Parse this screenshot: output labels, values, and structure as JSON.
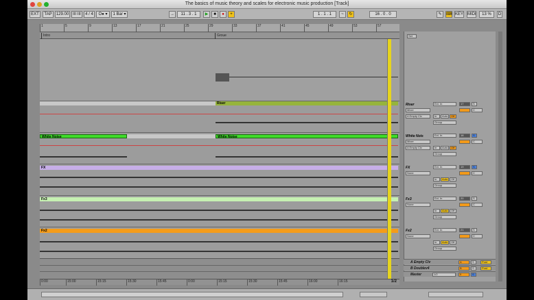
{
  "window": {
    "title": "The basics of music theory and scales for electronic music production  [Track]"
  },
  "transport": {
    "ext": "EXT",
    "tap": "TAP",
    "tempo": "129.00",
    "nudge": "III III",
    "sig": "4 / 4",
    "metro": "O● ▾",
    "quant": "1 Bar ▾",
    "position": "11 .  3 .  1",
    "loop_start": "1 .  1 .  1",
    "loop_len": "16 .  0 .  0",
    "key": "KEY",
    "midi": "MIDI",
    "cpu": "13 %",
    "d_label": "D"
  },
  "ruler": {
    "ticks": [
      "1",
      "5",
      "9",
      "13",
      "17",
      "21",
      "25",
      "29",
      "33",
      "37",
      "41",
      "45",
      "49",
      "53",
      "57"
    ]
  },
  "locators": [
    {
      "label": "Intro"
    },
    {
      "label": "Groue"
    }
  ],
  "tracks": [
    {
      "name": "Riser",
      "clip": "Riser",
      "input": "Ext. In",
      "mode": "Mixer",
      "out": "A Empty Clv",
      "num": "17",
      "group": "Group",
      "clip_color": "#96b43c"
    },
    {
      "name": "White Nois",
      "clip": "White Noise",
      "input": "Ext. In",
      "mode": "Mixer",
      "out": "A Empty Clv",
      "num": "18",
      "group": "Group",
      "clip_color": "#3fdc2a"
    },
    {
      "name": "FX",
      "clip": "FX",
      "input": "Ext. In",
      "mode": "None",
      "out": "",
      "num": "19",
      "group": "Group",
      "clip_color": "#c7aee8"
    },
    {
      "name": "Fx3",
      "clip": "Fx3",
      "input": "Ext. In",
      "mode": "None",
      "out": "",
      "num": "20",
      "group": "Group",
      "clip_color": "#c6f0b2"
    },
    {
      "name": "Fx2",
      "clip": "Fx2",
      "input": "Ext. In",
      "mode": "None",
      "out": "",
      "num": "21",
      "group": "Group",
      "clip_color": "#f49c1a"
    }
  ],
  "track_labels": {
    "in": "In",
    "auto": "Auto",
    "off": "Off",
    "s": "S",
    "c": "C"
  },
  "returns": [
    {
      "name": "A Empty Clv",
      "letter": "A",
      "post": "Post"
    },
    {
      "name": "B Doublev4",
      "letter": "B",
      "post": "Post"
    },
    {
      "name": "Master",
      "ratio": "1/2",
      "letter": "0"
    }
  ],
  "timeline": {
    "ticks": [
      "0:00",
      "15:00",
      "15:15",
      "15:30",
      "15:45",
      "0:00",
      "15:15",
      "15:30",
      "15:45",
      "16:00",
      "16:15"
    ],
    "fraction": "1/2"
  },
  "sets": {
    "label": "Set"
  },
  "colors": {
    "accent_yellow": "#e6d41e",
    "clip_orange": "#f49c1a"
  }
}
